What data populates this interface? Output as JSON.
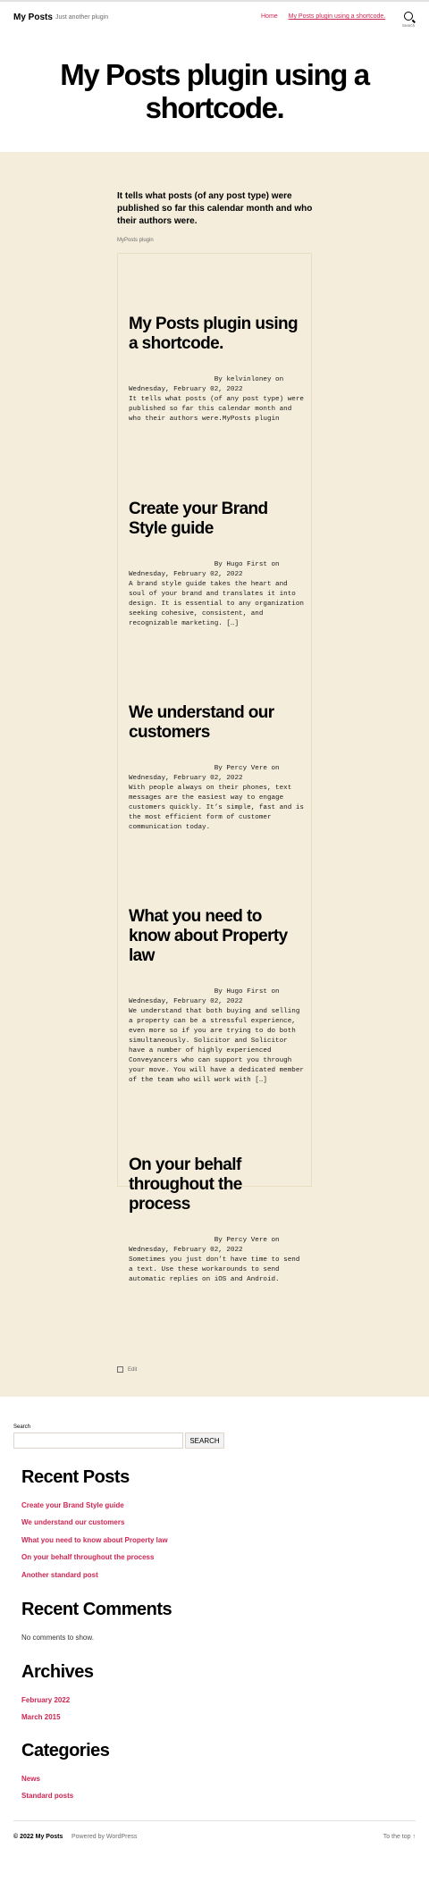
{
  "header": {
    "site_title": "My Posts",
    "site_description": "Just another plugin",
    "nav": [
      "Home",
      "My Posts plugin using a shortcode."
    ],
    "search_label": "Search"
  },
  "page": {
    "title": "My Posts plugin using a shortcode.",
    "intro": "It tells what posts (of any post type) were published so far this calendar month and who their authors were.",
    "caption": "MyPosts plugin",
    "edit_label": "Edit"
  },
  "posts": [
    {
      "title": "My Posts plugin using a shortcode.",
      "meta": "                     By kelvinloney on\nWednesday, February 02, 2022\nIt tells what posts (of any post type) were published so far this calendar month and who their authors were.MyPosts plugin"
    },
    {
      "title": "Create your Brand Style guide",
      "meta": "                     By Hugo First on\nWednesday, February 02, 2022\nA brand style guide takes the heart and soul of your brand and translates it into design. It is essential to any organization seeking cohesive, consistent, and recognizable marketing. […]"
    },
    {
      "title": "We understand our customers",
      "meta": "                     By Percy Vere on\nWednesday, February 02, 2022\nWith people always on their phones, text messages are the easiest way to engage customers quickly. It’s simple, fast and is the most efficient form of customer communication today."
    },
    {
      "title": "What you need to know about Property law",
      "meta": "                     By Hugo First on\nWednesday, February 02, 2022\nWe understand that both buying and selling a property can be a stressful experience, even more so if you are trying to do both simultaneously. Solicitor and Solicitor have a number of highly experienced Conveyancers who can support you through your move. You will have a dedicated member of the team who will work with […]"
    },
    {
      "title": "On your behalf throughout the process",
      "meta": "                     By Percy Vere on\nWednesday, February 02, 2022\nSometimes you just don’t have time to send a text. Use these workarounds to send automatic replies on iOS and Android."
    }
  ],
  "widgets": {
    "search_label": "Search",
    "search_button": "Search",
    "recent_posts_title": "Recent Posts",
    "recent_posts": [
      "Create your Brand Style guide",
      "We understand our customers",
      "What you need to know about Property law",
      "On your behalf throughout the process",
      "Another standard post"
    ],
    "recent_comments_title": "Recent Comments",
    "recent_comments_empty": "No comments to show.",
    "archives_title": "Archives",
    "archives": [
      "February 2022",
      "March 2015"
    ],
    "categories_title": "Categories",
    "categories": [
      "News",
      "Standard posts"
    ]
  },
  "footer": {
    "copyright": "© 2022 My Posts",
    "powered": "Powered by WordPress",
    "to_top": "To the top ↑"
  },
  "colors": {
    "accent": "#cd2653",
    "content_background": "#f4eddb",
    "secondary_text": "#6d6d6d"
  }
}
